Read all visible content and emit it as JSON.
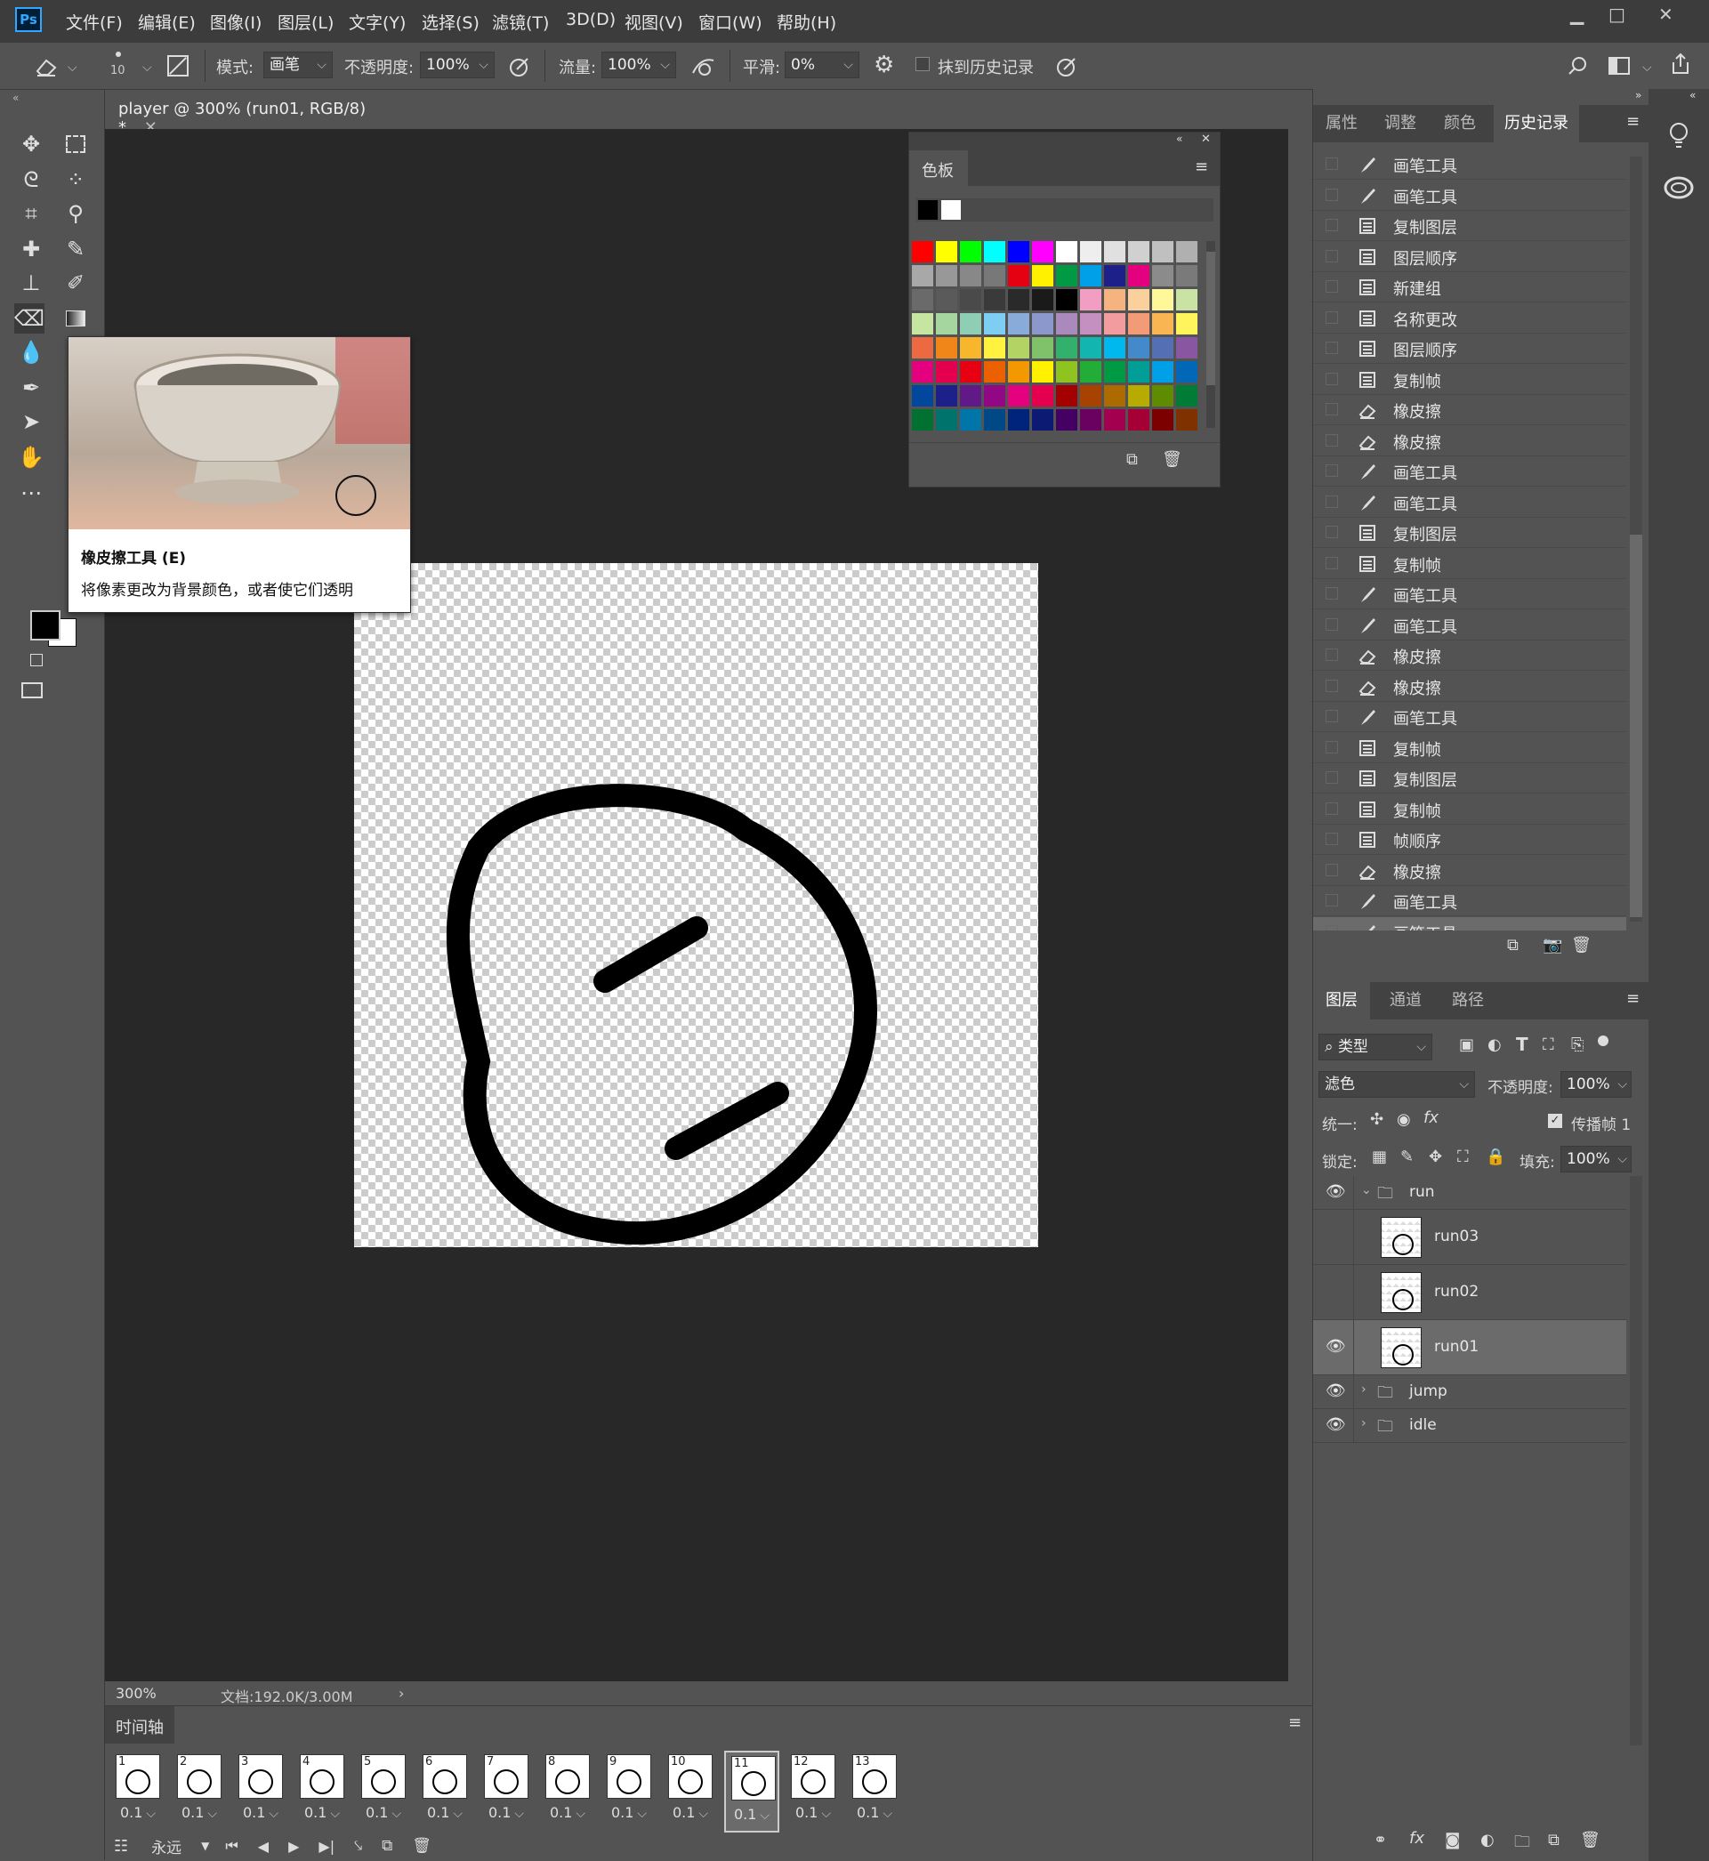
{
  "app": {
    "logo": "Ps"
  },
  "menu": [
    "文件(F)",
    "编辑(E)",
    "图像(I)",
    "图层(L)",
    "文字(Y)",
    "选择(S)",
    "滤镜(T)",
    "3D(D)",
    "视图(V)",
    "窗口(W)",
    "帮助(H)"
  ],
  "window_buttons": {
    "minimize": "▁",
    "maximize": "□",
    "close": "✕"
  },
  "options": {
    "brush_size": "10",
    "mode_label": "模式:",
    "mode_value": "画笔",
    "opacity_label": "不透明度:",
    "opacity_value": "100%",
    "flow_label": "流量:",
    "flow_value": "100%",
    "smooth_label": "平滑:",
    "smooth_value": "0%",
    "erase_history_label": "抹到历史记录"
  },
  "document": {
    "tab_title": "player @ 300% (run01, RGB/8) *",
    "zoom": "300%",
    "doc_info": "文档:192.0K/3.00M"
  },
  "tooltip": {
    "title": "橡皮擦工具 (E)",
    "description": "将像素更改为背景颜色，或者使它们透明"
  },
  "swatches": {
    "title": "色板",
    "colors": [
      [
        "#ff0000",
        "#ffff00",
        "#00ff00",
        "#00ffff",
        "#0000ff",
        "#ff00ff",
        "#ffffff",
        "#eeeeee",
        "#e0e0e0",
        "#d0d0d0",
        "#c0c0c0",
        "#b0b0b0"
      ],
      [
        "#a8a8a8",
        "#989898",
        "#888888",
        "#787878",
        "#e50012",
        "#fff100",
        "#009944",
        "#00a0e9",
        "#1d2088",
        "#e4007f",
        "#8b8b8b",
        "#7a7a7a"
      ],
      [
        "#6a6a6a",
        "#5a5a5a",
        "#4a4a4a",
        "#3a3a3a",
        "#2a2a2a",
        "#1a1a1a",
        "#000000",
        "#f19ec2",
        "#f6b37f",
        "#fad09c",
        "#fff799",
        "#c9e3a5"
      ],
      [
        "#c6e5a0",
        "#a6d6a0",
        "#8dceb4",
        "#7ecef4",
        "#88abda",
        "#8c97cb",
        "#aa89bd",
        "#c490bf",
        "#f29c9f",
        "#f29b76",
        "#f8b551",
        "#fff45c"
      ],
      [
        "#ec6941",
        "#f08519",
        "#f8b62d",
        "#fff33f",
        "#b3d465",
        "#80c269",
        "#32b16c",
        "#13b5b1",
        "#00b7ee",
        "#448aca",
        "#556fb5",
        "#8957a1"
      ],
      [
        "#e4007f",
        "#e5004f",
        "#e60012",
        "#eb6100",
        "#f39800",
        "#fff100",
        "#8fc31f",
        "#22ac38",
        "#009944",
        "#009e96",
        "#00a0e9",
        "#0068b7"
      ],
      [
        "#00479d",
        "#1d2088",
        "#601986",
        "#920783",
        "#e4007f",
        "#e5004f",
        "#a40000",
        "#a84200",
        "#ac6a00",
        "#b7aa00",
        "#5f8b00",
        "#007c36"
      ],
      [
        "#007130",
        "#00736d",
        "#0075a9",
        "#004986",
        "#00247b",
        "#0d1a73",
        "#440062",
        "#6a005f",
        "#a40050",
        "#a40035",
        "#7d0000",
        "#7f3100"
      ]
    ]
  },
  "right_tabs": [
    "属性",
    "调整",
    "颜色",
    "历史记录"
  ],
  "history": [
    {
      "icon": "brush-icon",
      "label": "画笔工具"
    },
    {
      "icon": "brush-icon",
      "label": "画笔工具"
    },
    {
      "icon": "document-icon",
      "label": "复制图层"
    },
    {
      "icon": "document-icon",
      "label": "图层顺序"
    },
    {
      "icon": "document-icon",
      "label": "新建组"
    },
    {
      "icon": "document-icon",
      "label": "名称更改"
    },
    {
      "icon": "document-icon",
      "label": "图层顺序"
    },
    {
      "icon": "document-icon",
      "label": "复制帧"
    },
    {
      "icon": "eraser-icon",
      "label": "橡皮擦"
    },
    {
      "icon": "eraser-icon",
      "label": "橡皮擦"
    },
    {
      "icon": "brush-icon",
      "label": "画笔工具"
    },
    {
      "icon": "brush-icon",
      "label": "画笔工具"
    },
    {
      "icon": "document-icon",
      "label": "复制图层"
    },
    {
      "icon": "document-icon",
      "label": "复制帧"
    },
    {
      "icon": "brush-icon",
      "label": "画笔工具"
    },
    {
      "icon": "brush-icon",
      "label": "画笔工具"
    },
    {
      "icon": "eraser-icon",
      "label": "橡皮擦"
    },
    {
      "icon": "eraser-icon",
      "label": "橡皮擦"
    },
    {
      "icon": "brush-icon",
      "label": "画笔工具"
    },
    {
      "icon": "document-icon",
      "label": "复制帧"
    },
    {
      "icon": "document-icon",
      "label": "复制图层"
    },
    {
      "icon": "document-icon",
      "label": "复制帧"
    },
    {
      "icon": "document-icon",
      "label": "帧顺序"
    },
    {
      "icon": "eraser-icon",
      "label": "橡皮擦"
    },
    {
      "icon": "brush-icon",
      "label": "画笔工具"
    },
    {
      "icon": "brush-icon",
      "label": "画笔工具"
    }
  ],
  "layers_tabs": [
    "图层",
    "通道",
    "路径"
  ],
  "layers_panel": {
    "filter_kind": "类型",
    "blend_mode": "滤色",
    "opacity_label": "不透明度:",
    "opacity_value": "100%",
    "unify_label": "统一:",
    "propagate_label": "传播帧 1",
    "lock_label": "锁定:",
    "fill_label": "填充:",
    "fill_value": "100%"
  },
  "layers": [
    {
      "name": "run",
      "type": "group",
      "expanded": true,
      "visible": true
    },
    {
      "name": "run03",
      "type": "layer",
      "visible": false
    },
    {
      "name": "run02",
      "type": "layer",
      "visible": false
    },
    {
      "name": "run01",
      "type": "layer",
      "visible": true,
      "selected": true
    },
    {
      "name": "jump",
      "type": "group",
      "expanded": false,
      "visible": true
    },
    {
      "name": "idle",
      "type": "group",
      "expanded": false,
      "visible": true
    }
  ],
  "timeline": {
    "title": "时间轴",
    "loop": "永远",
    "frames": [
      {
        "num": "1",
        "dur": "0.1"
      },
      {
        "num": "2",
        "dur": "0.1"
      },
      {
        "num": "3",
        "dur": "0.1"
      },
      {
        "num": "4",
        "dur": "0.1"
      },
      {
        "num": "5",
        "dur": "0.1"
      },
      {
        "num": "6",
        "dur": "0.1"
      },
      {
        "num": "7",
        "dur": "0.1"
      },
      {
        "num": "8",
        "dur": "0.1"
      },
      {
        "num": "9",
        "dur": "0.1"
      },
      {
        "num": "10",
        "dur": "0.1"
      },
      {
        "num": "11",
        "dur": "0.1",
        "selected": true
      },
      {
        "num": "12",
        "dur": "0.1"
      },
      {
        "num": "13",
        "dur": "0.1"
      }
    ]
  }
}
